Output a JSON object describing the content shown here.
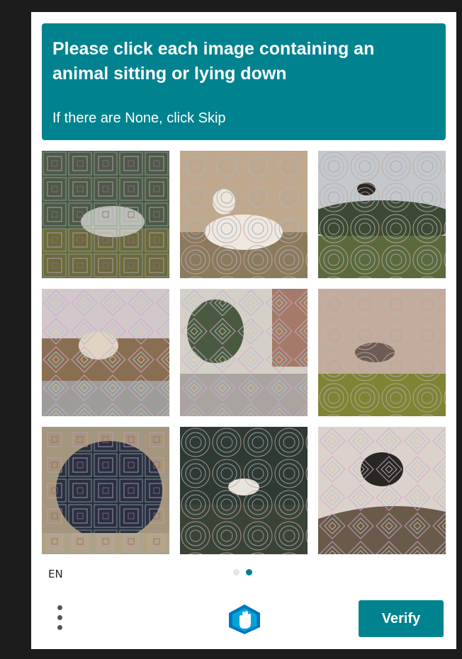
{
  "prompt": {
    "title": "Please click each image containing an animal sitting or lying down",
    "subtitle": "If there are None, click Skip"
  },
  "grid": {
    "tiles": [
      {
        "label": "tile-1",
        "motif": "squares",
        "scene": "sheep-blurry-field"
      },
      {
        "label": "tile-2",
        "motif": "circles",
        "scene": "lamb-lying"
      },
      {
        "label": "tile-3",
        "motif": "circles",
        "scene": "sheep-jumping-hill"
      },
      {
        "label": "tile-4",
        "motif": "diamonds",
        "scene": "sheep-leaping-field"
      },
      {
        "label": "tile-5",
        "motif": "diamonds",
        "scene": "street-trees"
      },
      {
        "label": "tile-6",
        "motif": "circles",
        "scene": "sheep-jumping-grass"
      },
      {
        "label": "tile-7",
        "motif": "squares",
        "scene": "sheep-closeup-dark"
      },
      {
        "label": "tile-8",
        "motif": "circles",
        "scene": "white-animal-forest"
      },
      {
        "label": "tile-9",
        "motif": "diamonds",
        "scene": "black-sheep-jumping"
      }
    ]
  },
  "footer": {
    "language": "EN",
    "page_dots": 2,
    "active_dot": 2,
    "verify_label": "Verify",
    "menu_icon": "more-vertical-icon",
    "logo_icon": "hcaptcha-logo-icon"
  },
  "colors": {
    "accent": "#00838f",
    "backdrop": "#1c1c1c"
  }
}
